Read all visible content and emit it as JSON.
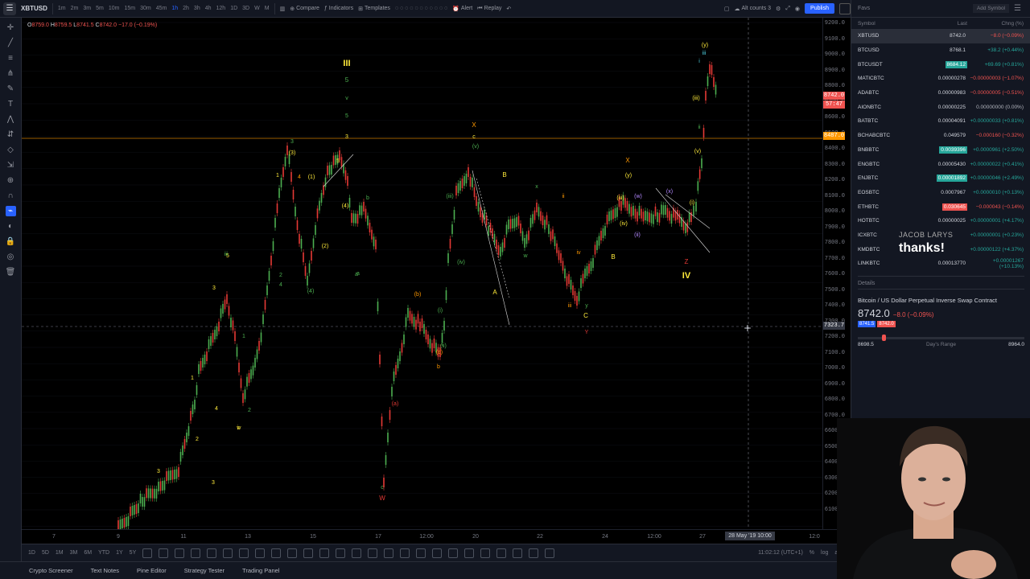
{
  "toolbar": {
    "symbol": "XBTUSD",
    "timeframes": [
      "1m",
      "2m",
      "3m",
      "5m",
      "10m",
      "15m",
      "30m",
      "45m",
      "1h",
      "2h",
      "3h",
      "4h",
      "12h",
      "1D",
      "3D",
      "W",
      "M"
    ],
    "active_timeframe": "1h",
    "compare_label": "Compare",
    "indicators_label": "Indicators",
    "templates_label": "Templates",
    "alert_label": "Alert",
    "replay_label": "Replay",
    "alt_label": "Alt counts 3",
    "publish_label": "Publish"
  },
  "ohlc": {
    "o_prefix": "O",
    "o": "8759.0",
    "h_prefix": "H",
    "h": "8759.5",
    "l_prefix": "L",
    "l": "8741.5",
    "c_prefix": "C",
    "c": "8742.0",
    "change": "−17.0 (−0.19%)"
  },
  "price_axis": {
    "ticks": [
      "9200.0",
      "9100.0",
      "9000.0",
      "8900.0",
      "8800.0",
      "8700.0",
      "8600.0",
      "8500.0",
      "8400.0",
      "8300.0",
      "8200.0",
      "8100.0",
      "8000.0",
      "7900.0",
      "7800.0",
      "7700.0",
      "7600.0",
      "7500.0",
      "7400.0",
      "7300.0",
      "7200.0",
      "7100.0",
      "7000.0",
      "6900.0",
      "6800.0",
      "6700.0",
      "6600.0",
      "6500.0",
      "6400.0",
      "6300.0",
      "6200.0",
      "6100.0"
    ],
    "last_price": "8742.0",
    "countdown": "57:47",
    "line_price": "8487.0",
    "cursor_price": "7323.7"
  },
  "time_axis": {
    "ticks": [
      "7",
      "9",
      "11",
      "13",
      "15",
      "17",
      "12:00",
      "20",
      "22",
      "24",
      "12:00",
      "27",
      "12:0"
    ],
    "cursor_time": "28 May '19  10:00"
  },
  "bottom_bar": {
    "ranges": [
      "1D",
      "5D",
      "1M",
      "3M",
      "6M",
      "YTD",
      "1Y",
      "5Y"
    ],
    "clock": "11:02:12 (UTC+1)",
    "percent": "%",
    "log": "log",
    "auto": "auto"
  },
  "footer_tabs": [
    "Crypto Screener",
    "Text Notes",
    "Pine Editor",
    "Strategy Tester",
    "Trading Panel"
  ],
  "watchlist": {
    "title": "Favs",
    "add_symbol": "Add Symbol",
    "col_symbol": "Symbol",
    "col_last": "Last",
    "col_chg": "Chng (%)",
    "rows": [
      {
        "symbol": "XBTUSD",
        "last": "8742.0",
        "change": "−8.0 (−0.09%)",
        "dir": "down",
        "hl": ""
      },
      {
        "symbol": "BTCUSD",
        "last": "8768.1",
        "change": "+38.2 (+0.44%)",
        "dir": "up",
        "hl": ""
      },
      {
        "symbol": "BTCUSDT",
        "last": "8684.12",
        "change": "+69.69 (+0.81%)",
        "dir": "up",
        "hl": "up"
      },
      {
        "symbol": "MATICBTC",
        "last": "0.00000278",
        "change": "−0.00000003 (−1.07%)",
        "dir": "down",
        "hl": ""
      },
      {
        "symbol": "ADABTC",
        "last": "0.00000983",
        "change": "−0.00000005 (−0.51%)",
        "dir": "down",
        "hl": ""
      },
      {
        "symbol": "AIONBTC",
        "last": "0.00000225",
        "change": "0.00000000 (0.00%)",
        "dir": "flat",
        "hl": ""
      },
      {
        "symbol": "BATBTC",
        "last": "0.00004091",
        "change": "+0.00000033 (+0.81%)",
        "dir": "up",
        "hl": ""
      },
      {
        "symbol": "BCHABCBTC",
        "last": "0.049579",
        "change": "−0.000160 (−0.32%)",
        "dir": "down",
        "hl": ""
      },
      {
        "symbol": "BNBBTC",
        "last": "0.0039396",
        "change": "+0.0000961 (+2.50%)",
        "dir": "up",
        "hl": "up"
      },
      {
        "symbol": "ENGBTC",
        "last": "0.00005430",
        "change": "+0.00000022 (+0.41%)",
        "dir": "up",
        "hl": ""
      },
      {
        "symbol": "ENJBTC",
        "last": "0.00001892",
        "change": "+0.00000046 (+2.49%)",
        "dir": "up",
        "hl": "up"
      },
      {
        "symbol": "EOSBTC",
        "last": "0.0007967",
        "change": "+0.0000010 (+0.13%)",
        "dir": "up",
        "hl": ""
      },
      {
        "symbol": "ETHBTC",
        "last": "0.030645",
        "change": "−0.000043 (−0.14%)",
        "dir": "down",
        "hl": "down"
      },
      {
        "symbol": "HOTBTC",
        "last": "0.00000025",
        "change": "+0.00000001 (+4.17%)",
        "dir": "up",
        "hl": ""
      },
      {
        "symbol": "ICXBTC",
        "last": "",
        "change": "+0.00000001 (+0.23%)",
        "dir": "up",
        "hl": ""
      },
      {
        "symbol": "KMDBTC",
        "last": "",
        "change": "+0.00000122 (+4.37%)",
        "dir": "up",
        "hl": ""
      },
      {
        "symbol": "LINKBTC",
        "last": "0.00013770",
        "change": "+0.00001267 (+10.13%)",
        "dir": "up",
        "hl": ""
      }
    ]
  },
  "details": {
    "title": "Details",
    "name": "Bitcoin / US Dollar Perpetual Inverse Swap Contract",
    "price": "8742.0",
    "change": "−8.0 (−0.09%)",
    "bid": "8741.5",
    "ask": "8742.0",
    "low": "8698.5",
    "range_label": "Day's Range",
    "high": "8964.0"
  },
  "comment": {
    "author": "JACOB LARYS",
    "text": "thanks!"
  },
  "colors": {
    "up": "#26a69a",
    "down": "#ef5350",
    "accent": "#2962ff",
    "wave_green": "#4caf50",
    "wave_yellow": "#ffeb3b",
    "wave_orange": "#ff9800",
    "wave_purple": "#b388ff",
    "wave_cyan": "#4dd0e1",
    "wave_red": "#e53935"
  },
  "wave_labels": [
    "III",
    "5",
    "v",
    "5",
    "3",
    "3",
    "(3)",
    "1",
    "(1)",
    "4",
    "5",
    "(4)",
    "(2)",
    "2",
    "b",
    "a",
    "X",
    "c",
    "(v)",
    "B",
    "(iii)",
    "(iv)",
    "x",
    "w",
    "A",
    "ii",
    "iv",
    "iii",
    "y",
    "C",
    "Y",
    "X",
    "(y)",
    "(w)",
    "(x)",
    "(iii)",
    "(iv)",
    "(ii)",
    "B",
    "Z",
    "IV",
    "(y)",
    "iii",
    "(i)",
    "ii",
    "(v)",
    "(iii)",
    "4",
    "3",
    "1",
    "2",
    "5",
    "iii",
    "3",
    "iv",
    "(4)",
    "a",
    "(a)",
    "(b)",
    "(i)",
    "(c)",
    "(ii)",
    "b",
    "c",
    "W",
    "3",
    "4",
    "1",
    "2",
    "i",
    "v"
  ]
}
